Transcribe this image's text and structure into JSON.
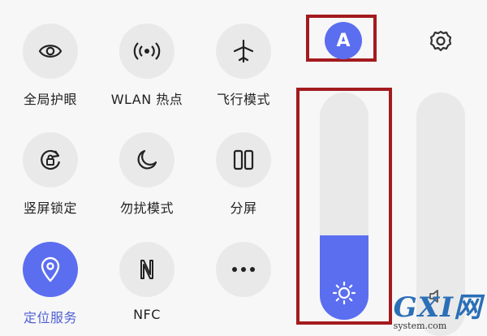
{
  "tiles": [
    {
      "label": "全局护眼",
      "icon": "eye-icon"
    },
    {
      "label": "WLAN 热点",
      "icon": "hotspot-icon"
    },
    {
      "label": "飞行模式",
      "icon": "airplane-icon"
    },
    {
      "label": "竖屏锁定",
      "icon": "rotation-lock-icon"
    },
    {
      "label": "勿扰模式",
      "icon": "moon-icon"
    },
    {
      "label": "分屏",
      "icon": "split-screen-icon"
    },
    {
      "label": "定位服务",
      "icon": "location-pin-icon",
      "active": true
    },
    {
      "label": "NFC",
      "icon": "nfc-icon"
    },
    {
      "label": "",
      "icon": "more-icon"
    }
  ],
  "brightness": {
    "auto_label": "A",
    "level": 0.37,
    "icon": "sun-icon"
  },
  "volume": {
    "icon": "speaker-icon"
  },
  "settings": {
    "icon": "gear-icon"
  },
  "watermark": {
    "brand": "GXI网",
    "domain": "system.com"
  },
  "colors": {
    "accent": "#5b6ef0",
    "highlight_box": "#a31b1e",
    "tile_bg": "#e9e9e9",
    "background": "#f7f7f7",
    "active_label": "#4f5fd6"
  }
}
